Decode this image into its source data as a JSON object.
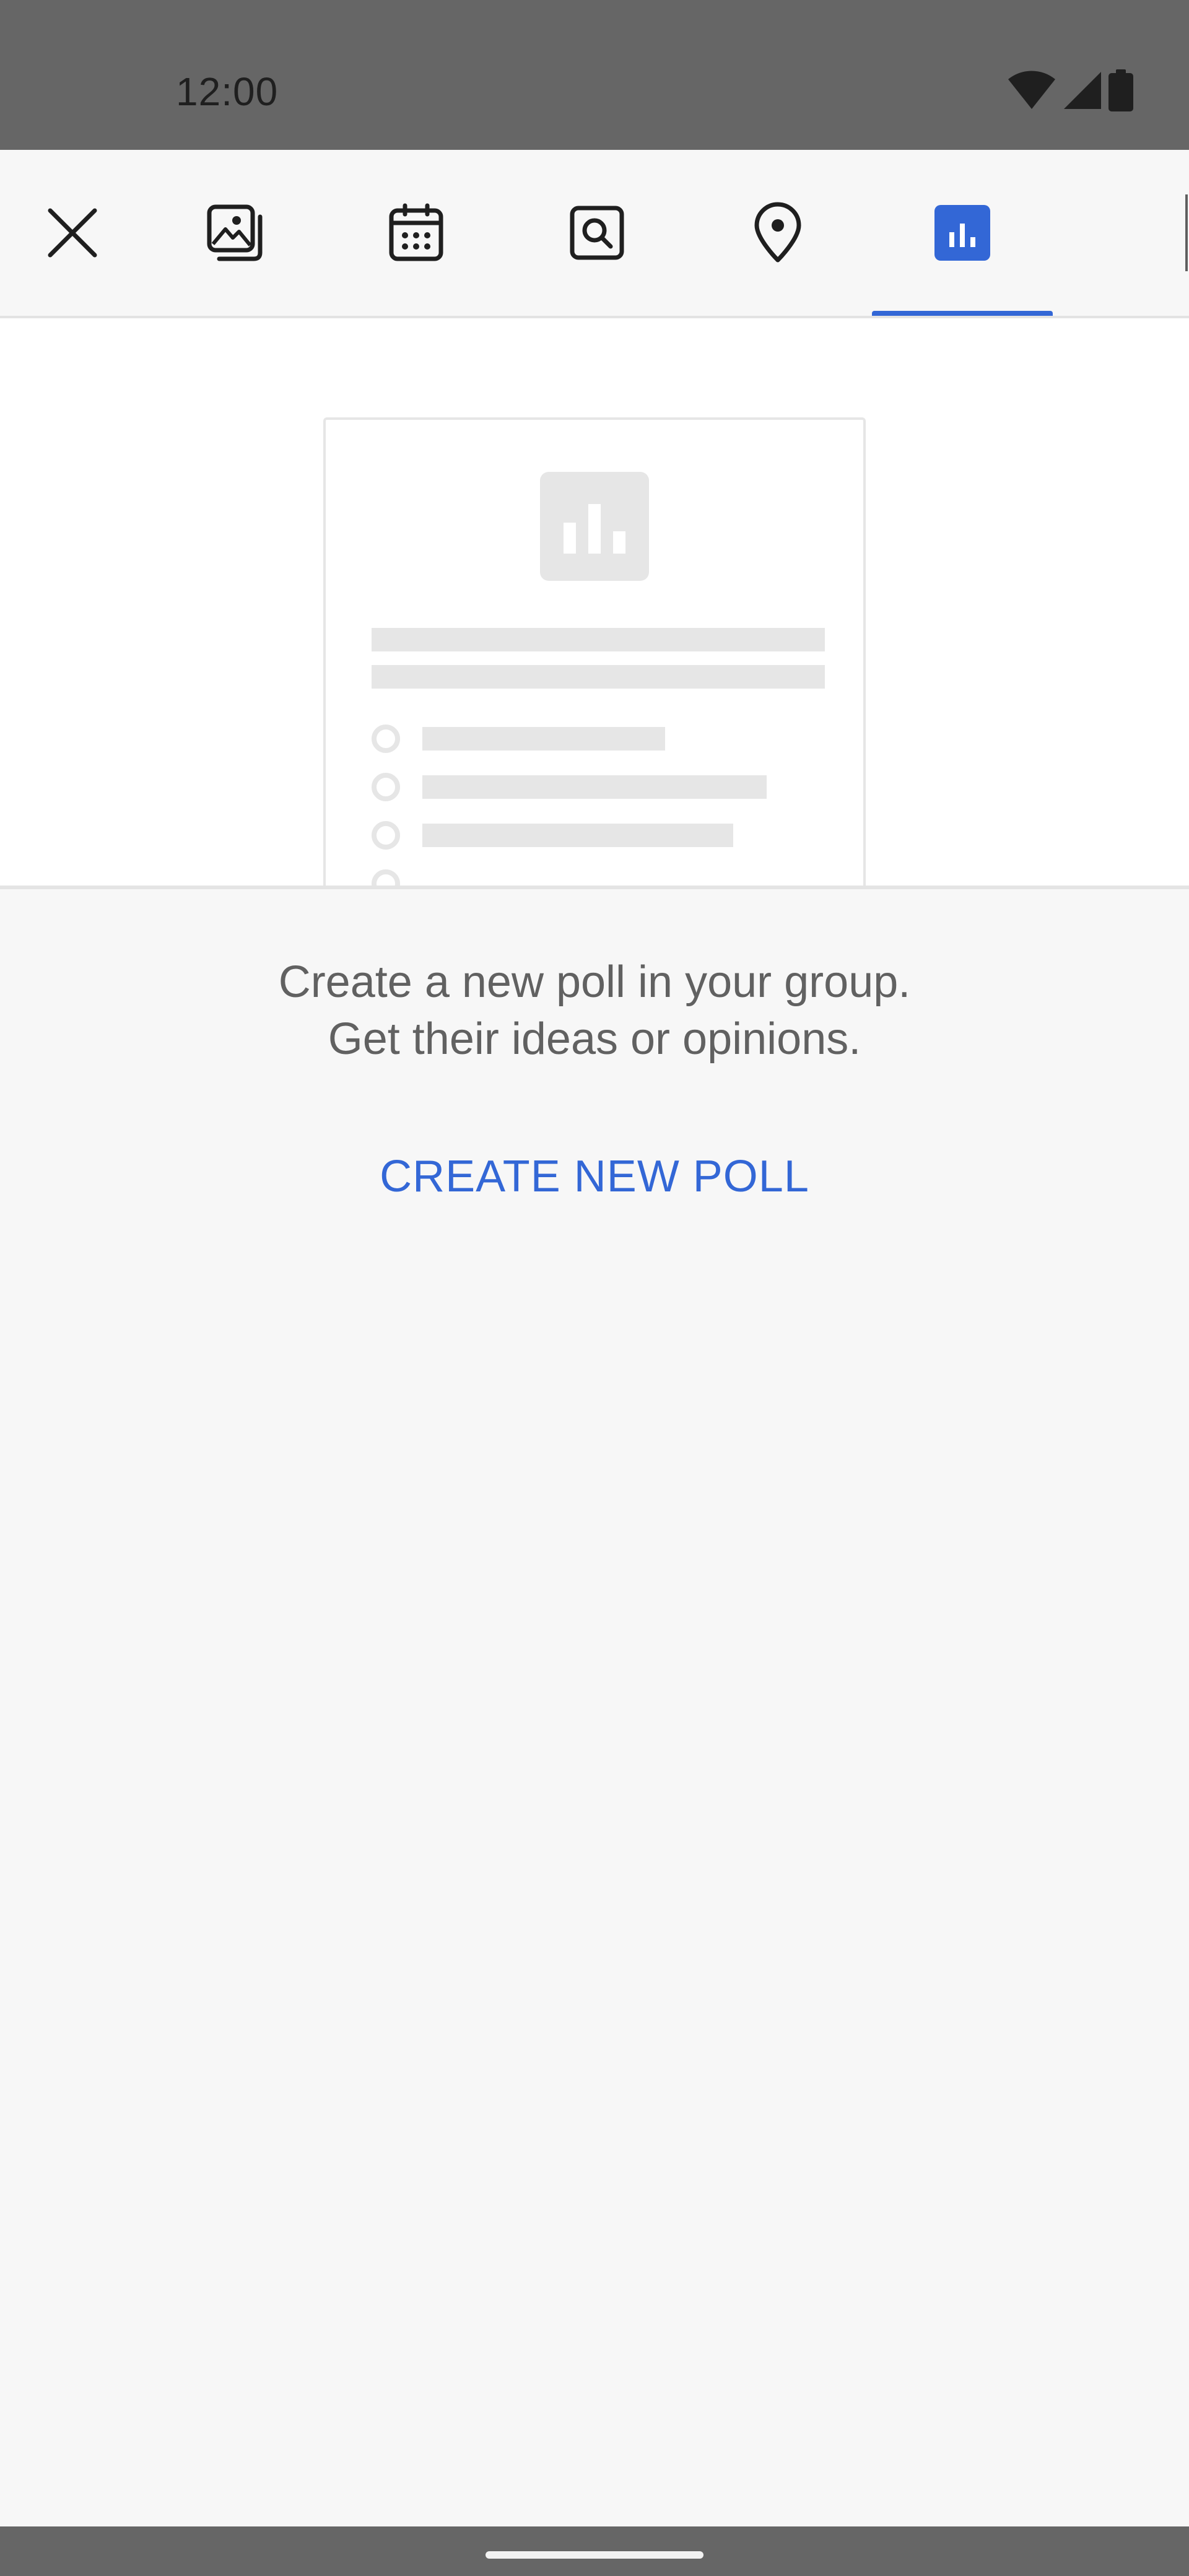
{
  "status_bar": {
    "time": "12:00",
    "icons": [
      "wifi-icon",
      "cellular-signal-icon",
      "battery-icon"
    ]
  },
  "toolbar": {
    "buttons": [
      {
        "name": "close",
        "icon": "close-icon"
      },
      {
        "name": "gallery",
        "icon": "image-gallery-icon"
      },
      {
        "name": "event",
        "icon": "calendar-icon"
      },
      {
        "name": "search",
        "icon": "image-search-icon"
      },
      {
        "name": "location",
        "icon": "location-pin-icon"
      },
      {
        "name": "poll",
        "icon": "poll-chart-icon",
        "selected": true
      }
    ],
    "accent_color": "#3367d6"
  },
  "poll_info": {
    "description_line1": "Create a new poll in your group.",
    "description_line2": "Get their ideas or opinions.",
    "action_label": "CREATE NEW POLL"
  },
  "colors": {
    "accent": "#3367d6",
    "status_bar": "#666666",
    "background": "#f7f7f7",
    "text_secondary": "#616161"
  }
}
